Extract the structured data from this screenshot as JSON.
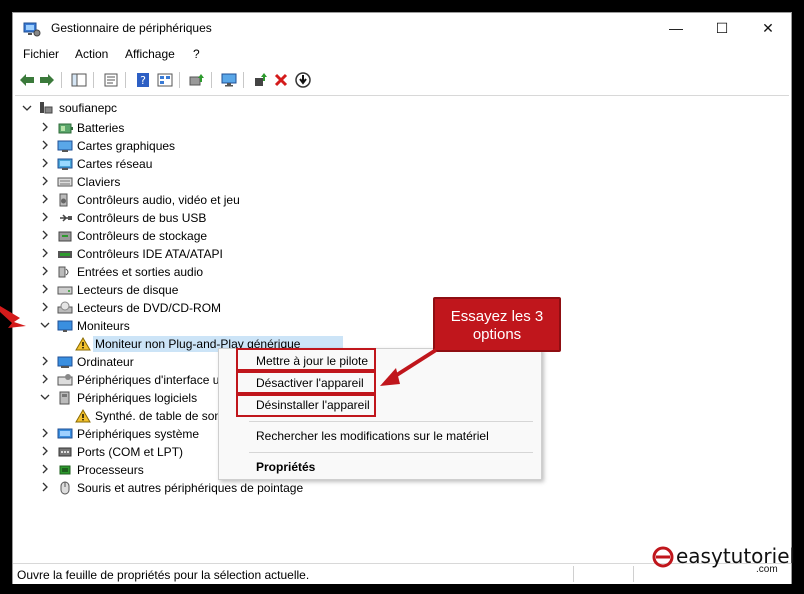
{
  "window": {
    "title": "Gestionnaire de périphériques",
    "minimize_glyph": "—",
    "maximize_glyph": "☐",
    "close_glyph": "✕"
  },
  "menu": [
    "Fichier",
    "Action",
    "Affichage",
    "?"
  ],
  "tree": {
    "root": "soufianepc",
    "items": [
      {
        "label": "Batteries",
        "icon": "battery-icon",
        "expanded": false
      },
      {
        "label": "Cartes graphiques",
        "icon": "display-adapter-icon",
        "expanded": false
      },
      {
        "label": "Cartes réseau",
        "icon": "network-adapter-icon",
        "expanded": false
      },
      {
        "label": "Claviers",
        "icon": "keyboard-icon",
        "expanded": false
      },
      {
        "label": "Contrôleurs audio, vidéo et jeu",
        "icon": "speaker-icon",
        "expanded": false
      },
      {
        "label": "Contrôleurs de bus USB",
        "icon": "usb-icon",
        "expanded": false
      },
      {
        "label": "Contrôleurs de stockage",
        "icon": "storage-controller-icon",
        "expanded": false
      },
      {
        "label": "Contrôleurs IDE ATA/ATAPI",
        "icon": "ide-controller-icon",
        "expanded": false
      },
      {
        "label": "Entrées et sorties audio",
        "icon": "audio-io-icon",
        "expanded": false
      },
      {
        "label": "Lecteurs de disque",
        "icon": "disk-drive-icon",
        "expanded": false
      },
      {
        "label": "Lecteurs de DVD/CD-ROM",
        "icon": "dvd-icon",
        "expanded": false
      },
      {
        "label": "Moniteurs",
        "icon": "monitor-icon",
        "expanded": true
      },
      {
        "label": "Moniteur non Plug-and-Play générique",
        "icon": "warning-monitor-icon",
        "child": true,
        "selected": true
      },
      {
        "label": "Ordinateur",
        "icon": "computer-icon",
        "expanded": false
      },
      {
        "label": "Périphériques d'interface u",
        "icon": "hid-icon",
        "expanded": false
      },
      {
        "label": "Périphériques logiciels",
        "icon": "software-device-icon",
        "expanded": true
      },
      {
        "label": "Synthé. de table de son",
        "icon": "warning-device-icon",
        "child": true
      },
      {
        "label": "Périphériques système",
        "icon": "system-device-icon",
        "expanded": false
      },
      {
        "label": "Ports (COM et LPT)",
        "icon": "port-icon",
        "expanded": false
      },
      {
        "label": "Processeurs",
        "icon": "processor-icon",
        "expanded": false
      },
      {
        "label": "Souris et autres périphériques de pointage",
        "icon": "mouse-icon",
        "expanded": false
      }
    ]
  },
  "context_menu": {
    "update_driver": "Mettre à jour le pilote",
    "disable_device": "Désactiver l'appareil",
    "uninstall_device": "Désinstaller l'appareil",
    "scan_hardware": "Rechercher les modifications sur le matériel",
    "properties": "Propriétés"
  },
  "callout": {
    "line1": "Essayez les 3",
    "line2": "options"
  },
  "status": {
    "text": "Ouvre la feuille de propriétés pour la sélection actuelle."
  },
  "brand": {
    "name": "easytutoriel",
    "tld": ".com"
  },
  "colors": {
    "accent_red": "#c0161c",
    "selection": "#cce4f7",
    "link_blue": "#1e6fd0"
  }
}
